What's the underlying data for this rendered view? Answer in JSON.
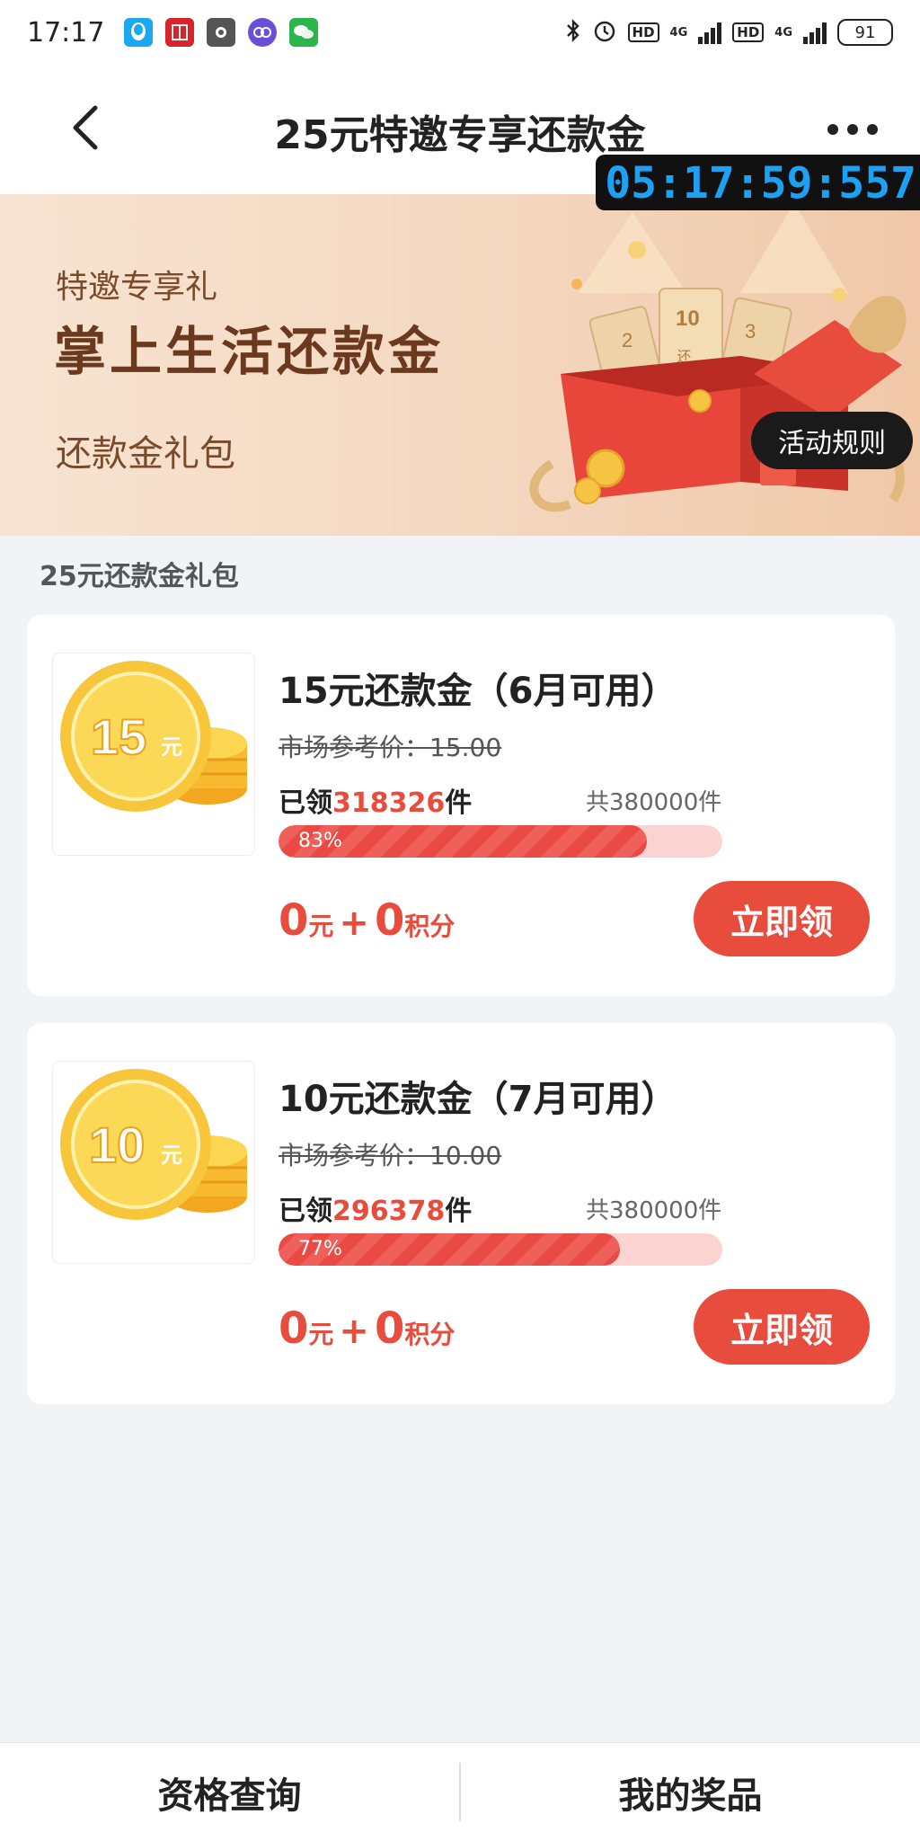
{
  "status_bar": {
    "time": "17:17",
    "network_label": "4G",
    "hd_label": "HD",
    "battery": "91"
  },
  "nav": {
    "title": "25元特邀专享还款金",
    "timer_overlay": "05:17:59:557"
  },
  "banner": {
    "subtitle": "特邀专享礼",
    "title": "掌上生活还款金",
    "tag": "还款金礼包",
    "rules_button": "活动规则",
    "ticket_labels": [
      "2",
      "10",
      "3"
    ],
    "ticket_text": "还款金"
  },
  "section_title": "25元还款金礼包",
  "items": [
    {
      "coin_value": "15",
      "coin_unit": "元",
      "title": "15元还款金（6月可用）",
      "ref_price": "市场参考价：15.00",
      "claimed_prefix": "已领",
      "claimed_count": "318326",
      "claimed_suffix": "件",
      "total": "共380000件",
      "progress_pct": "83%",
      "progress_value": 0.83,
      "price_yuan": "0",
      "price_yuan_unit": "元",
      "plus": "+",
      "price_points": "0",
      "price_points_unit": "积分",
      "button": "立即领"
    },
    {
      "coin_value": "10",
      "coin_unit": "元",
      "title": "10元还款金（7月可用）",
      "ref_price": "市场参考价：10.00",
      "claimed_prefix": "已领",
      "claimed_count": "296378",
      "claimed_suffix": "件",
      "total": "共380000件",
      "progress_pct": "77%",
      "progress_value": 0.77,
      "price_yuan": "0",
      "price_yuan_unit": "元",
      "plus": "+",
      "price_points": "0",
      "price_points_unit": "积分",
      "button": "立即领"
    }
  ],
  "bottom_bar": {
    "left": "资格查询",
    "right": "我的奖品"
  },
  "colors": {
    "accent_red": "#e84c3d",
    "timer_blue": "#1da1f2"
  }
}
